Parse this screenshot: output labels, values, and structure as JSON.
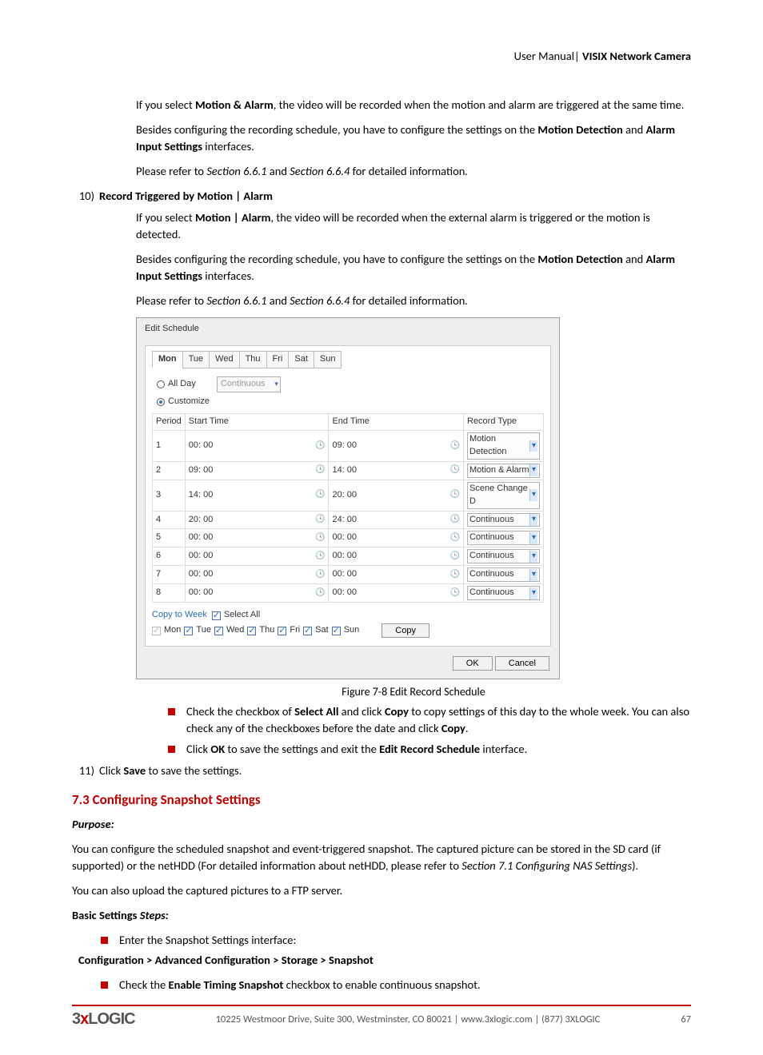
{
  "header": {
    "left": "User Manual",
    "sep": "| ",
    "right": "VISIX Network Camera"
  },
  "para1": {
    "a": "If you select ",
    "b": "Motion & Alarm",
    "c": ", the video will be recorded when the motion and alarm are triggered at the same time."
  },
  "para2": {
    "a": "Besides configuring the recording schedule, you have to configure the settings on the ",
    "b": "Motion Detection",
    "c": " and ",
    "d": "Alarm Input Settings",
    "e": " interfaces."
  },
  "para3": {
    "a": "Please refer to ",
    "b": "Section 6.6.1",
    "c": " and ",
    "d": "Section 6.6.4",
    "e": " for detailed information",
    "f": "."
  },
  "item10": {
    "num": "10)",
    "title": "Record Triggered by Motion | Alarm"
  },
  "para4": {
    "a": "If you select ",
    "b": "Motion | Alarm",
    "c": ", the video will be recorded when the external alarm is triggered or the motion is detected."
  },
  "dialog": {
    "title": "Edit Schedule",
    "tabs": [
      "Mon",
      "Tue",
      "Wed",
      "Thu",
      "Fri",
      "Sat",
      "Sun"
    ],
    "allDay": "All Day",
    "customize": "Customize",
    "ddDisabled": "Continuous",
    "cols": {
      "period": "Period",
      "start": "Start Time",
      "end": "End Time",
      "type": "Record Type"
    },
    "rows": [
      {
        "p": "1",
        "s": "00: 00",
        "e": "09: 00",
        "t": "Motion Detection"
      },
      {
        "p": "2",
        "s": "09: 00",
        "e": "14: 00",
        "t": "Motion & Alarm"
      },
      {
        "p": "3",
        "s": "14: 00",
        "e": "20: 00",
        "t": "Scene Change D"
      },
      {
        "p": "4",
        "s": "20: 00",
        "e": "24: 00",
        "t": "Continuous"
      },
      {
        "p": "5",
        "s": "00: 00",
        "e": "00: 00",
        "t": "Continuous"
      },
      {
        "p": "6",
        "s": "00: 00",
        "e": "00: 00",
        "t": "Continuous"
      },
      {
        "p": "7",
        "s": "00: 00",
        "e": "00: 00",
        "t": "Continuous"
      },
      {
        "p": "8",
        "s": "00: 00",
        "e": "00: 00",
        "t": "Continuous"
      }
    ],
    "copyLabel": "Copy to Week",
    "selectAll": "Select All",
    "days": [
      "Mon",
      "Tue",
      "Wed",
      "Thu",
      "Fri",
      "Sat",
      "Sun"
    ],
    "copyBtn": "Copy",
    "ok": "OK",
    "cancel": "Cancel"
  },
  "caption": {
    "a": "Figure 7-8 ",
    "b": "Edit Record Schedule"
  },
  "bullet1": {
    "a": "Check the checkbox of ",
    "b": "Select All",
    "c": " and click ",
    "d": "Copy",
    "e": " to copy settings of this day to the whole week. You can also check any of the checkboxes before the date and click ",
    "f": "Copy",
    "g": "."
  },
  "bullet2": {
    "a": "Click ",
    "b": "OK",
    "c": " to save the settings and exit the ",
    "d": "Edit Record Schedule",
    "e": " interface."
  },
  "item11": {
    "num": "11)",
    "a": "Click ",
    "b": "Save",
    "c": " to save the settings."
  },
  "section": {
    "num": "7.3",
    "title": "Configuring Snapshot Settings"
  },
  "purpose": "Purpose:",
  "para5": {
    "a": "You can configure the scheduled snapshot and event-triggered snapshot. The captured picture can be stored in the SD card (if supported) or the netHDD (For detailed information about netHDD, please refer to ",
    "b": "Section 7.1 Configuring NAS Settings",
    "c": ")."
  },
  "para6": "You can also upload the captured pictures to a FTP server.",
  "basicSteps": {
    "a": "Basic Settings ",
    "b": "Steps:"
  },
  "bullet3": "Enter the Snapshot Settings interface:",
  "navPath": "Configuration > Advanced Configuration > Storage > Snapshot",
  "bullet4": {
    "a": "Check the ",
    "b": "Enable Timing Snapshot",
    "c": " checkbox to enable continuous snapshot."
  },
  "footer": {
    "logo": {
      "a": "3",
      "b": "x",
      "c": "LOGIC"
    },
    "addr": "10225 Westmoor Drive, Suite 300, Westminster, CO 80021 | www.3xlogic.com | (877) 3XLOGIC",
    "page": "67"
  }
}
